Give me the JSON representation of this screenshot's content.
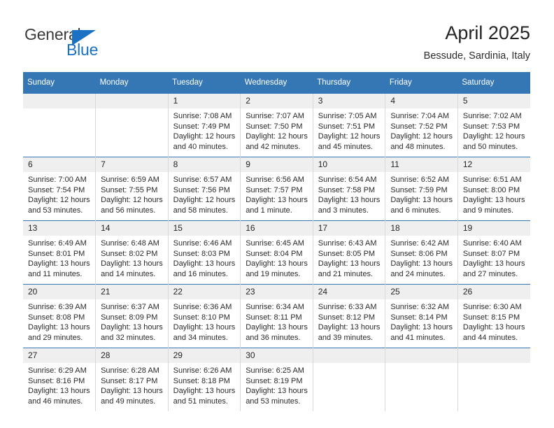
{
  "logo": {
    "primary_text": "General",
    "secondary_text": "Blue",
    "triangle_icon": "triangle-icon",
    "primary_color": "#3b3b3b",
    "accent_color": "#1b71c4"
  },
  "header": {
    "title": "April 2025",
    "subtitle": "Bessude, Sardinia, Italy"
  },
  "theme": {
    "header_bar_color": "#3577b5",
    "daynum_band_color": "#efefef",
    "cell_border_color": "#d8d8d8",
    "text_color": "#2a2a2a"
  },
  "calendar": {
    "columns": [
      "Sunday",
      "Monday",
      "Tuesday",
      "Wednesday",
      "Thursday",
      "Friday",
      "Saturday"
    ],
    "weeks": [
      [
        {
          "day": "",
          "lines": []
        },
        {
          "day": "",
          "lines": []
        },
        {
          "day": "1",
          "lines": [
            "Sunrise: 7:08 AM",
            "Sunset: 7:49 PM",
            "Daylight: 12 hours",
            "and 40 minutes."
          ]
        },
        {
          "day": "2",
          "lines": [
            "Sunrise: 7:07 AM",
            "Sunset: 7:50 PM",
            "Daylight: 12 hours",
            "and 42 minutes."
          ]
        },
        {
          "day": "3",
          "lines": [
            "Sunrise: 7:05 AM",
            "Sunset: 7:51 PM",
            "Daylight: 12 hours",
            "and 45 minutes."
          ]
        },
        {
          "day": "4",
          "lines": [
            "Sunrise: 7:04 AM",
            "Sunset: 7:52 PM",
            "Daylight: 12 hours",
            "and 48 minutes."
          ]
        },
        {
          "day": "5",
          "lines": [
            "Sunrise: 7:02 AM",
            "Sunset: 7:53 PM",
            "Daylight: 12 hours",
            "and 50 minutes."
          ]
        }
      ],
      [
        {
          "day": "6",
          "lines": [
            "Sunrise: 7:00 AM",
            "Sunset: 7:54 PM",
            "Daylight: 12 hours",
            "and 53 minutes."
          ]
        },
        {
          "day": "7",
          "lines": [
            "Sunrise: 6:59 AM",
            "Sunset: 7:55 PM",
            "Daylight: 12 hours",
            "and 56 minutes."
          ]
        },
        {
          "day": "8",
          "lines": [
            "Sunrise: 6:57 AM",
            "Sunset: 7:56 PM",
            "Daylight: 12 hours",
            "and 58 minutes."
          ]
        },
        {
          "day": "9",
          "lines": [
            "Sunrise: 6:56 AM",
            "Sunset: 7:57 PM",
            "Daylight: 13 hours",
            "and 1 minute."
          ]
        },
        {
          "day": "10",
          "lines": [
            "Sunrise: 6:54 AM",
            "Sunset: 7:58 PM",
            "Daylight: 13 hours",
            "and 3 minutes."
          ]
        },
        {
          "day": "11",
          "lines": [
            "Sunrise: 6:52 AM",
            "Sunset: 7:59 PM",
            "Daylight: 13 hours",
            "and 6 minutes."
          ]
        },
        {
          "day": "12",
          "lines": [
            "Sunrise: 6:51 AM",
            "Sunset: 8:00 PM",
            "Daylight: 13 hours",
            "and 9 minutes."
          ]
        }
      ],
      [
        {
          "day": "13",
          "lines": [
            "Sunrise: 6:49 AM",
            "Sunset: 8:01 PM",
            "Daylight: 13 hours",
            "and 11 minutes."
          ]
        },
        {
          "day": "14",
          "lines": [
            "Sunrise: 6:48 AM",
            "Sunset: 8:02 PM",
            "Daylight: 13 hours",
            "and 14 minutes."
          ]
        },
        {
          "day": "15",
          "lines": [
            "Sunrise: 6:46 AM",
            "Sunset: 8:03 PM",
            "Daylight: 13 hours",
            "and 16 minutes."
          ]
        },
        {
          "day": "16",
          "lines": [
            "Sunrise: 6:45 AM",
            "Sunset: 8:04 PM",
            "Daylight: 13 hours",
            "and 19 minutes."
          ]
        },
        {
          "day": "17",
          "lines": [
            "Sunrise: 6:43 AM",
            "Sunset: 8:05 PM",
            "Daylight: 13 hours",
            "and 21 minutes."
          ]
        },
        {
          "day": "18",
          "lines": [
            "Sunrise: 6:42 AM",
            "Sunset: 8:06 PM",
            "Daylight: 13 hours",
            "and 24 minutes."
          ]
        },
        {
          "day": "19",
          "lines": [
            "Sunrise: 6:40 AM",
            "Sunset: 8:07 PM",
            "Daylight: 13 hours",
            "and 27 minutes."
          ]
        }
      ],
      [
        {
          "day": "20",
          "lines": [
            "Sunrise: 6:39 AM",
            "Sunset: 8:08 PM",
            "Daylight: 13 hours",
            "and 29 minutes."
          ]
        },
        {
          "day": "21",
          "lines": [
            "Sunrise: 6:37 AM",
            "Sunset: 8:09 PM",
            "Daylight: 13 hours",
            "and 32 minutes."
          ]
        },
        {
          "day": "22",
          "lines": [
            "Sunrise: 6:36 AM",
            "Sunset: 8:10 PM",
            "Daylight: 13 hours",
            "and 34 minutes."
          ]
        },
        {
          "day": "23",
          "lines": [
            "Sunrise: 6:34 AM",
            "Sunset: 8:11 PM",
            "Daylight: 13 hours",
            "and 36 minutes."
          ]
        },
        {
          "day": "24",
          "lines": [
            "Sunrise: 6:33 AM",
            "Sunset: 8:12 PM",
            "Daylight: 13 hours",
            "and 39 minutes."
          ]
        },
        {
          "day": "25",
          "lines": [
            "Sunrise: 6:32 AM",
            "Sunset: 8:14 PM",
            "Daylight: 13 hours",
            "and 41 minutes."
          ]
        },
        {
          "day": "26",
          "lines": [
            "Sunrise: 6:30 AM",
            "Sunset: 8:15 PM",
            "Daylight: 13 hours",
            "and 44 minutes."
          ]
        }
      ],
      [
        {
          "day": "27",
          "lines": [
            "Sunrise: 6:29 AM",
            "Sunset: 8:16 PM",
            "Daylight: 13 hours",
            "and 46 minutes."
          ]
        },
        {
          "day": "28",
          "lines": [
            "Sunrise: 6:28 AM",
            "Sunset: 8:17 PM",
            "Daylight: 13 hours",
            "and 49 minutes."
          ]
        },
        {
          "day": "29",
          "lines": [
            "Sunrise: 6:26 AM",
            "Sunset: 8:18 PM",
            "Daylight: 13 hours",
            "and 51 minutes."
          ]
        },
        {
          "day": "30",
          "lines": [
            "Sunrise: 6:25 AM",
            "Sunset: 8:19 PM",
            "Daylight: 13 hours",
            "and 53 minutes."
          ]
        },
        {
          "day": "",
          "lines": []
        },
        {
          "day": "",
          "lines": []
        },
        {
          "day": "",
          "lines": []
        }
      ]
    ]
  }
}
